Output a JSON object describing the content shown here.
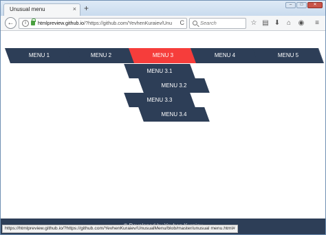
{
  "browser": {
    "tab_title": "Unusual menu",
    "tab_close": "×",
    "new_tab": "+",
    "window_controls": [
      "–",
      "□",
      "✕"
    ],
    "back": "←",
    "url_host": "htmlpreview.github.io",
    "url_rest": "/?https://github.com/YevhenKuraiev/Unu",
    "reload": "C",
    "search_placeholder": "Search",
    "toolbar_icons": [
      "star-icon",
      "clipboard-icon",
      "download-icon",
      "home-icon",
      "pocket-icon",
      "hamburger-menu-icon"
    ],
    "toolbar_glyphs": [
      "☆",
      "▤",
      "⬇",
      "⌂",
      "◉",
      "≡"
    ]
  },
  "menu": {
    "items": [
      "MENU 1",
      "MENU 2",
      "MENU 3",
      "MENU 4",
      "MENU 5"
    ],
    "active_index": 2,
    "active_color": "#f63d3b",
    "base_color": "#2d3e57",
    "submenu": [
      "MENU 3.1",
      "MENU 3.2",
      "MENU 3.3",
      "MENU 3.4"
    ]
  },
  "footer": {
    "text": "© Developed by Yevhen Kuraiev"
  },
  "status": {
    "link": "https://htmlpreview.github.io/?https://github.com/YevhenKuraiev/UnusualMenu/blob/master/unusual menu.html#"
  }
}
